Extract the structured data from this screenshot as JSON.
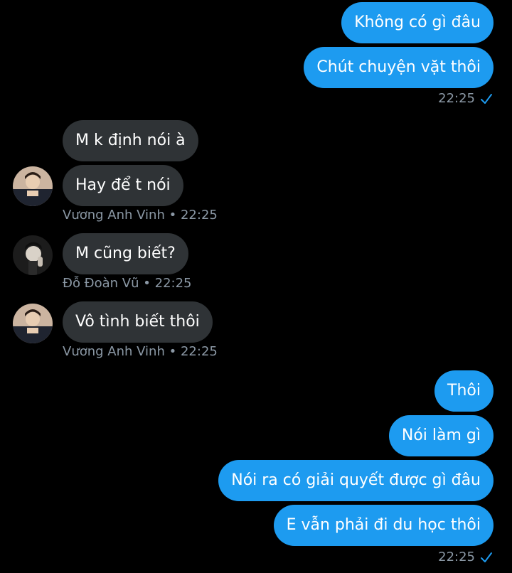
{
  "conversation": {
    "group1": {
      "messages": [
        "Không có gì đâu",
        "Chút chuyện vặt thôi"
      ],
      "time": "22:25",
      "status_icon": "read-check-icon"
    },
    "group2": {
      "messages": [
        "M k định nói à",
        "Hay để t nói"
      ],
      "sender": "Vương Anh Vinh",
      "separator": "•",
      "time": "22:25"
    },
    "group3": {
      "messages": [
        "M cũng biết?"
      ],
      "sender": "Đỗ Đoàn Vũ",
      "separator": "•",
      "time": "22:25"
    },
    "group4": {
      "messages": [
        "Vô tình biết thôi"
      ],
      "sender": "Vương Anh Vinh",
      "separator": "•",
      "time": "22:25"
    },
    "group5": {
      "messages": [
        "Thôi",
        "Nói làm gì",
        "Nói ra có giải quyết được gì đâu",
        "E vẫn phải đi du học thôi"
      ],
      "time": "22:25",
      "status_icon": "read-check-icon"
    }
  },
  "colors": {
    "background": "#000000",
    "outgoing_bubble": "#1d9bf0",
    "incoming_bubble": "#2f3336",
    "meta_text": "#8b98a5",
    "check": "#1d9bf0"
  }
}
